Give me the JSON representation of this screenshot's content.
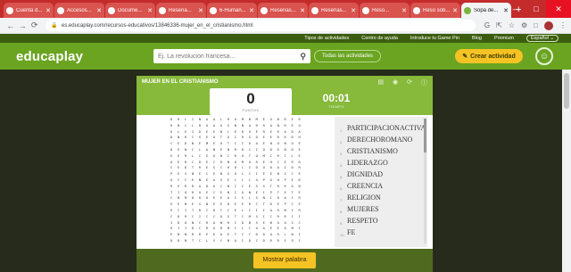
{
  "browser": {
    "tabs": [
      {
        "label": "Cuenta d...",
        "active": false
      },
      {
        "label": "Accesos...",
        "active": false
      },
      {
        "label": "Docume...",
        "active": false
      },
      {
        "label": "Resena...",
        "active": false
      },
      {
        "label": "6-Human...",
        "active": false
      },
      {
        "label": "Resenas...",
        "active": false
      },
      {
        "label": "Resenas...",
        "active": false
      },
      {
        "label": "Reso...",
        "active": false
      },
      {
        "label": "Reso sob...",
        "active": false
      },
      {
        "label": "Sopa de...",
        "active": true
      }
    ],
    "url": "es.educaplay.com/recursos-educativos/13846336-mujer_en_el_cristianismo.html"
  },
  "top_links": [
    "Tipos de actividades",
    "Centro de ayuda",
    "Introduce tu Game Pin",
    "Blog",
    "Premium"
  ],
  "language": "Español",
  "header": {
    "logo": "educaplay",
    "search_placeholder": "Ej. La revolución francesa...",
    "all_activities": "Todas las actividades",
    "create_label": "Crear actividad"
  },
  "game": {
    "title": "MUJER EN EL CRISTIANISMO",
    "score": "0",
    "score_label": "PUNTOS",
    "time": "00:01",
    "time_label": "TIEMPO",
    "grid_rows": [
      "D R L I N A A L R U M B M E U B R E R",
      "R N C L R U A U S N N A R R O N R E O",
      "O L E I D E E N L E R U E R E R A D A",
      "D N R C S E A T U I R S D E E R R R H",
      "C E D N E M E O T C I O A E N O N O E",
      "D E N C L A N E N R D C I O D E B D E",
      "E E R L C E O N C R O T O M I R C L E",
      "O E R C D E C R N O M O R E H C E R D",
      "C E D T R E S C H D C I D O D A I D R",
      "P E S N E C E N S O L I I E E N Z C E",
      "O C C E N E A S E L L C A P O H P E D",
      "R E R R A D O C N I I E S S T R E O B",
      "T I O R U E C E N I O N E I P T E T E",
      "C N M D O O E E A I S L S N I D A I R",
      "E E N E S N E E D E E R C T D E P C E",
      "E C I T R C D T C E L I I I A R N I R",
      "C D R C I C C O S T C M S I C R R I I",
      "I D O N C R A N R I D B S E B O A S C",
      "R I I D C R A D N C L C A A E E O N I",
      "E N N R R E E A E T I C D D A R L N I",
      "D D N T C L S Y N A I D C D R R S O I"
    ],
    "words": [
      "PARTICIPACIONACTIVA",
      "DERECHOROMANO",
      "CRISTIANISMO",
      "LIDERAZGO",
      "DIGNIDAD",
      "CREENCIA",
      "RELIGION",
      "MUJERES",
      "RESPETO",
      "FE"
    ],
    "show_word_label": "Mostrar palabra"
  }
}
